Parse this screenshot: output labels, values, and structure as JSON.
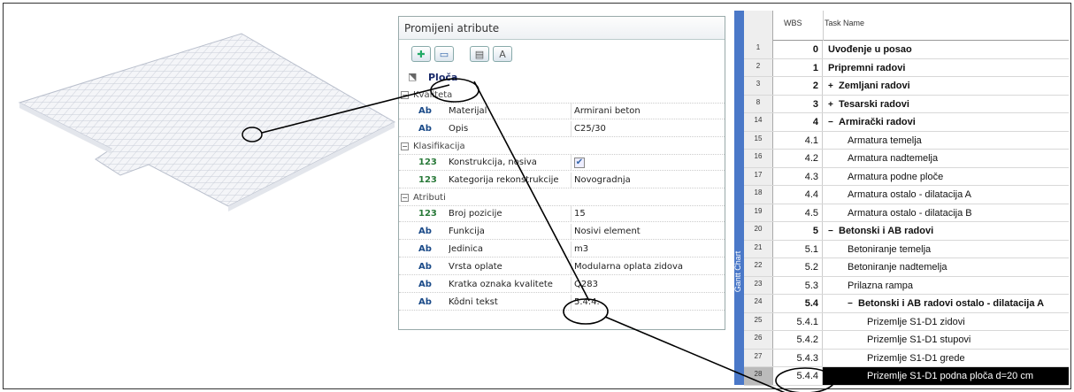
{
  "panel": {
    "title": "Promijeni atribute",
    "object_name": "Ploča",
    "groups": [
      {
        "label": "Kvaliteta",
        "rows": [
          {
            "icon": "Ab",
            "name": "Materijal",
            "value": "Armirani beton"
          },
          {
            "icon": "Ab",
            "name": "Opis",
            "value": "C25/30"
          }
        ]
      },
      {
        "label": "Klasifikacija",
        "rows": [
          {
            "icon": "123",
            "name": "Konstrukcija, nosiva",
            "value": ""
          },
          {
            "icon": "123",
            "name": "Kategorija rekonstrukcije",
            "value": "Novogradnja"
          }
        ]
      },
      {
        "label": "Atributi",
        "rows": [
          {
            "icon": "123",
            "name": "Broj pozicije",
            "value": "15"
          },
          {
            "icon": "Ab",
            "name": "Funkcija",
            "value": "Nosivi element"
          },
          {
            "icon": "Ab",
            "name": "Jedinica",
            "value": "m3"
          },
          {
            "icon": "Ab",
            "name": "Vrsta oplate",
            "value": "Modularna oplata zidova"
          },
          {
            "icon": "Ab",
            "name": "Kratka oznaka kvalitete",
            "value": "Q283"
          },
          {
            "icon": "Ab",
            "name": "Kôdni tekst",
            "value": "5.4.4."
          }
        ]
      }
    ]
  },
  "gantt": {
    "side_label": "Gantt Chart",
    "headers": {
      "wbs": "WBS",
      "name": "Task Name"
    },
    "rows": [
      {
        "id": "1",
        "wbs": "0",
        "name": "Uvođenje u posao",
        "bold": true,
        "indent": 0,
        "exp": ""
      },
      {
        "id": "2",
        "wbs": "1",
        "name": "Pripremni radovi",
        "bold": true,
        "indent": 0,
        "exp": ""
      },
      {
        "id": "3",
        "wbs": "2",
        "name": "Zemljani radovi",
        "bold": true,
        "indent": 0,
        "exp": "+"
      },
      {
        "id": "8",
        "wbs": "3",
        "name": "Tesarski radovi",
        "bold": true,
        "indent": 0,
        "exp": "+"
      },
      {
        "id": "14",
        "wbs": "4",
        "name": "Armirački radovi",
        "bold": true,
        "indent": 0,
        "exp": "−"
      },
      {
        "id": "15",
        "wbs": "4.1",
        "name": "Armatura temelja",
        "bold": false,
        "indent": 1,
        "exp": ""
      },
      {
        "id": "16",
        "wbs": "4.2",
        "name": "Armatura nadtemelja",
        "bold": false,
        "indent": 1,
        "exp": ""
      },
      {
        "id": "17",
        "wbs": "4.3",
        "name": "Armatura podne ploče",
        "bold": false,
        "indent": 1,
        "exp": ""
      },
      {
        "id": "18",
        "wbs": "4.4",
        "name": "Armatura ostalo - dilatacija A",
        "bold": false,
        "indent": 1,
        "exp": ""
      },
      {
        "id": "19",
        "wbs": "4.5",
        "name": "Armatura ostalo - dilatacija B",
        "bold": false,
        "indent": 1,
        "exp": ""
      },
      {
        "id": "20",
        "wbs": "5",
        "name": "Betonski i AB radovi",
        "bold": true,
        "indent": 0,
        "exp": "−"
      },
      {
        "id": "21",
        "wbs": "5.1",
        "name": "Betoniranje temelja",
        "bold": false,
        "indent": 1,
        "exp": ""
      },
      {
        "id": "22",
        "wbs": "5.2",
        "name": "Betoniranje nadtemelja",
        "bold": false,
        "indent": 1,
        "exp": ""
      },
      {
        "id": "23",
        "wbs": "5.3",
        "name": "Prilazna rampa",
        "bold": false,
        "indent": 1,
        "exp": ""
      },
      {
        "id": "24",
        "wbs": "5.4",
        "name": "Betonski i AB radovi ostalo - dilatacija A",
        "bold": true,
        "indent": 1,
        "exp": "−"
      },
      {
        "id": "25",
        "wbs": "5.4.1",
        "name": "Prizemlje S1-D1 zidovi",
        "bold": false,
        "indent": 2,
        "exp": ""
      },
      {
        "id": "26",
        "wbs": "5.4.2",
        "name": "Prizemlje S1-D1 stupovi",
        "bold": false,
        "indent": 2,
        "exp": ""
      },
      {
        "id": "27",
        "wbs": "5.4.3",
        "name": "Prizemlje S1-D1 grede",
        "bold": false,
        "indent": 2,
        "exp": ""
      },
      {
        "id": "28",
        "wbs": "5.4.4",
        "name": "Prizemlje S1-D1 podna ploča d=20 cm",
        "bold": false,
        "indent": 2,
        "exp": "",
        "selected": true
      }
    ]
  }
}
